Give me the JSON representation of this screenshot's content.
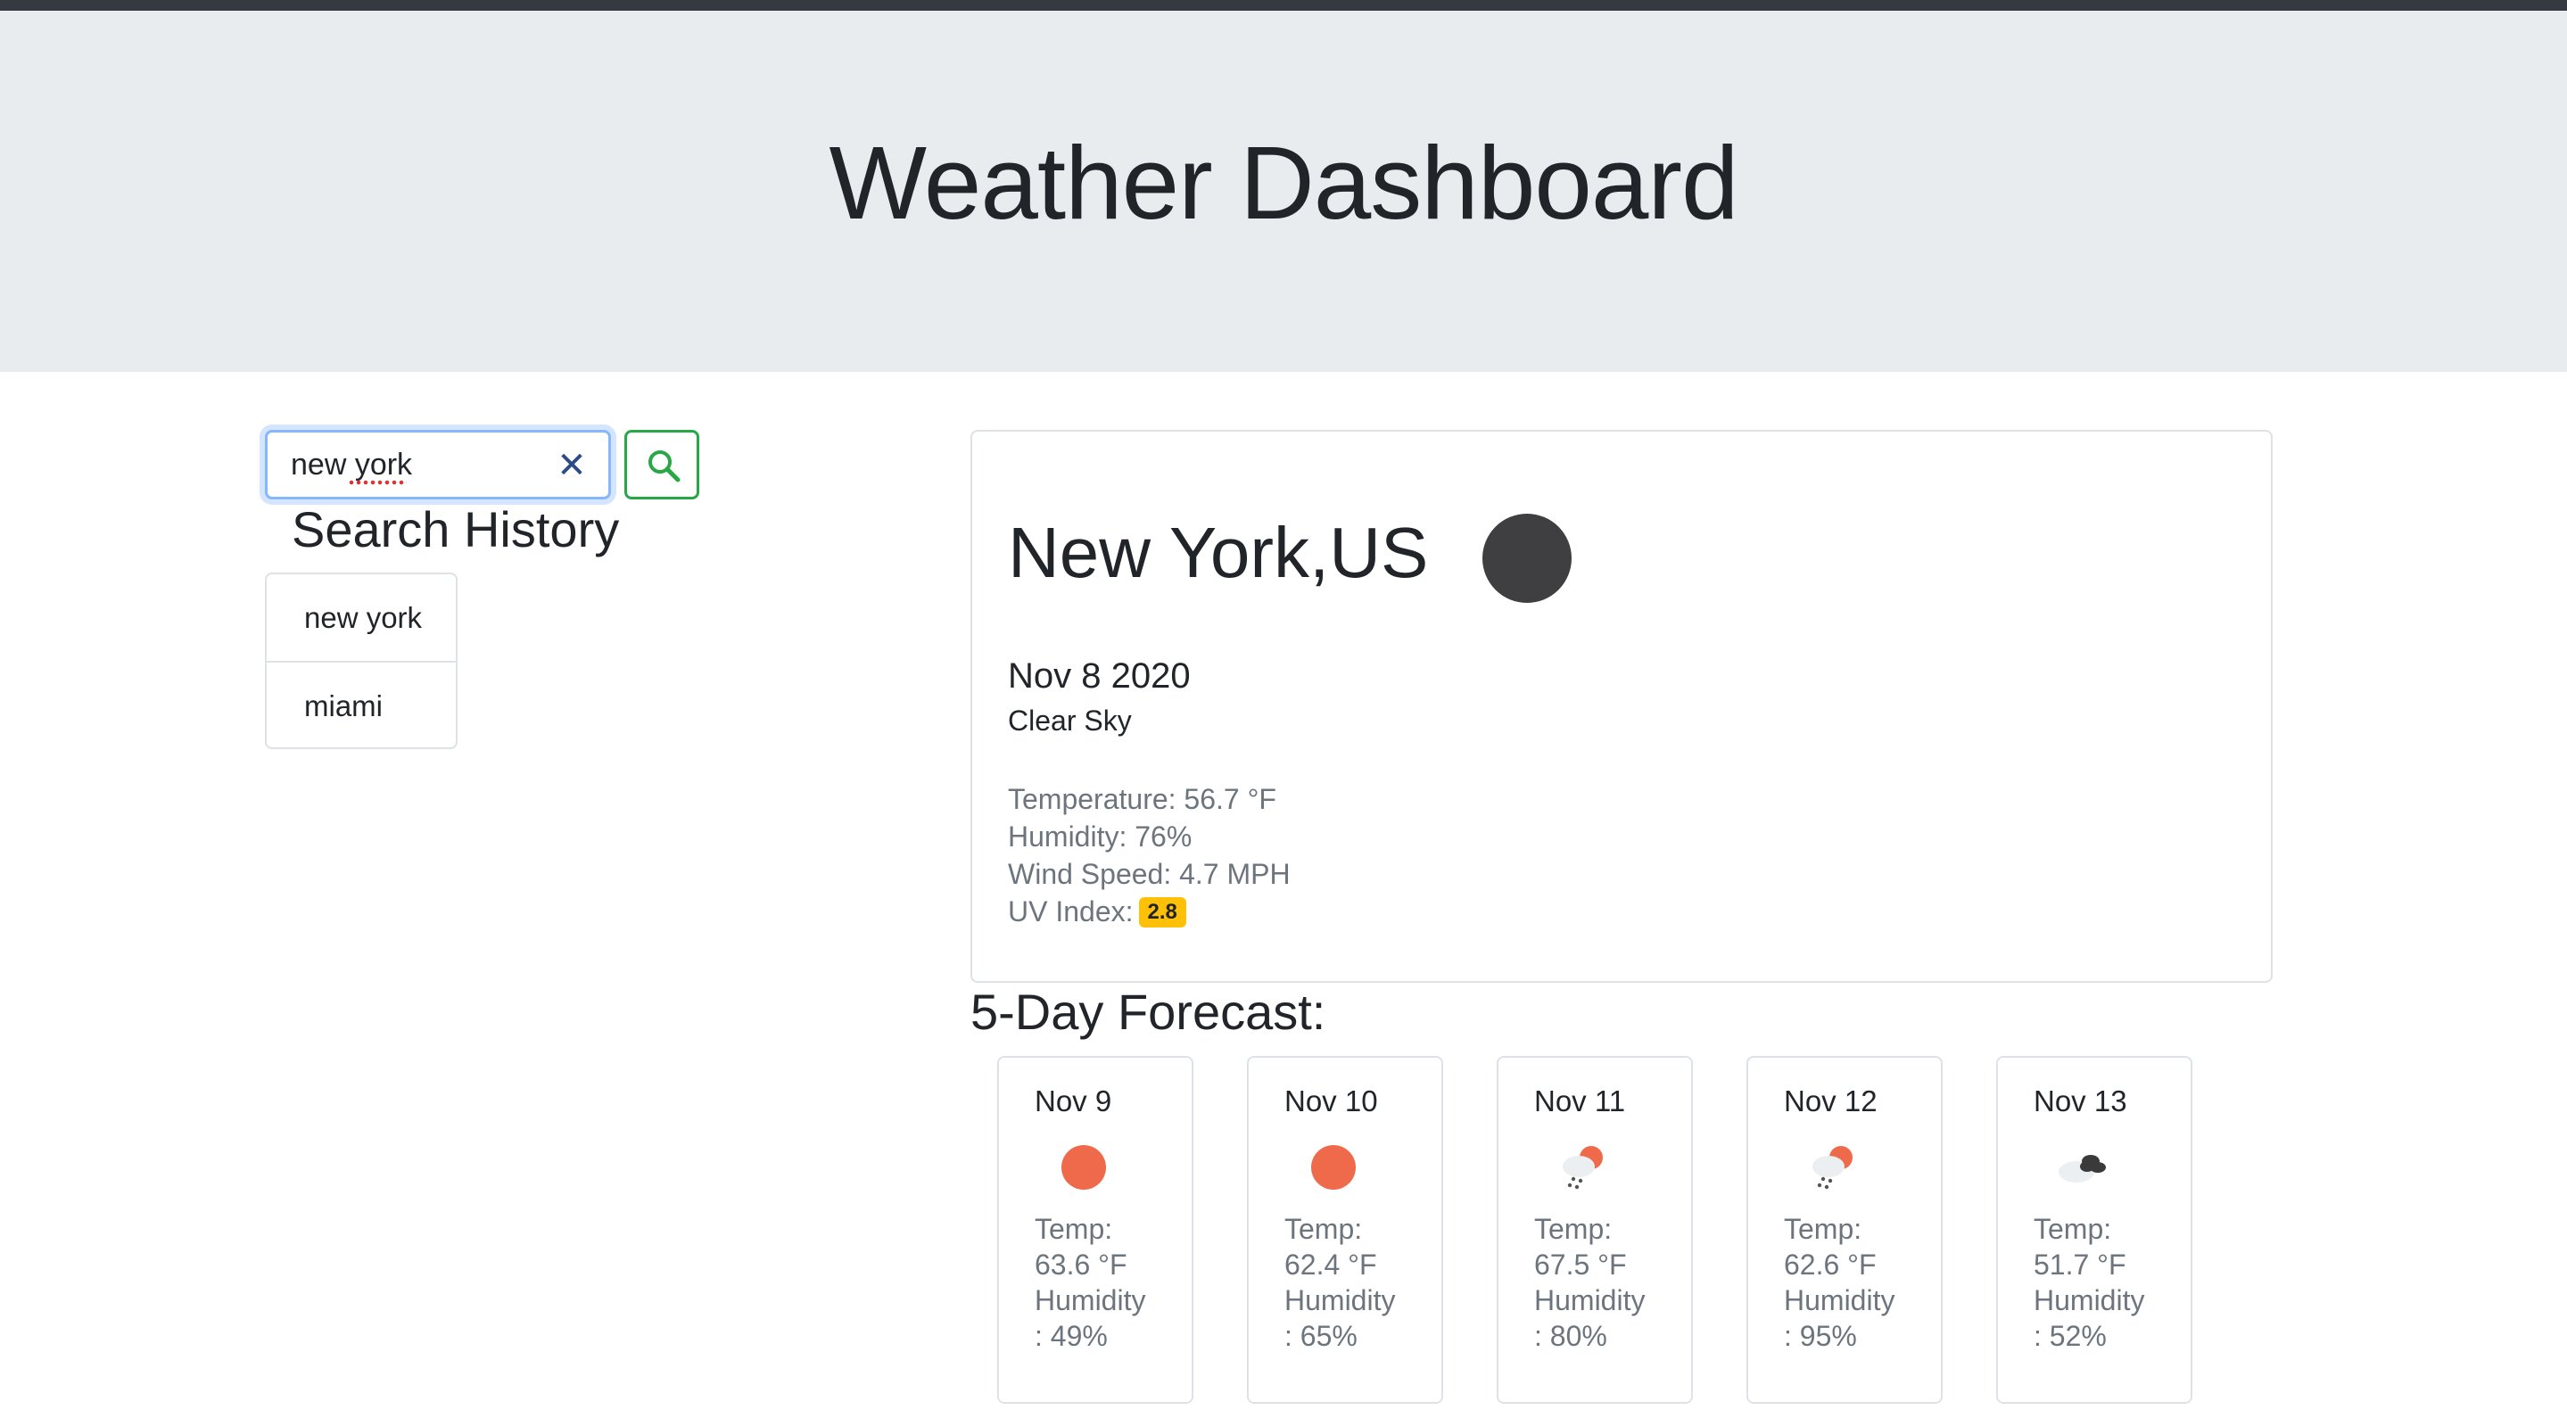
{
  "header": {
    "title": "Weather Dashboard"
  },
  "search": {
    "value": "new york",
    "clear_icon": "close-icon",
    "button_icon": "search-icon",
    "accent_color": "#28a745"
  },
  "history": {
    "heading": "Search History",
    "items": [
      {
        "label": "new york"
      },
      {
        "label": "miami"
      }
    ]
  },
  "current": {
    "city": "New York,US",
    "icon": "clear-night-icon",
    "date": "Nov 8 2020",
    "description": "Clear Sky",
    "temperature": "Temperature: 56.7 °F",
    "humidity": "Humidity: 76%",
    "wind": "Wind Speed: 4.7 MPH",
    "uv_label": "UV Index:",
    "uv_value": "2.8",
    "uv_color": "#ffc107"
  },
  "forecast": {
    "heading": "5-Day Forecast:",
    "days": [
      {
        "date": "Nov 9",
        "icon": "sun-icon",
        "temp_label": "Temp:",
        "temp": "63.6 °F",
        "hum_label": "Humidity",
        "hum": ": 49%"
      },
      {
        "date": "Nov 10",
        "icon": "sun-icon",
        "temp_label": "Temp:",
        "temp": "62.4 °F",
        "hum_label": "Humidity",
        "hum": ": 65%"
      },
      {
        "date": "Nov 11",
        "icon": "rain-sun-cloud-icon",
        "temp_label": "Temp:",
        "temp": "67.5 °F",
        "hum_label": "Humidity",
        "hum": ": 80%"
      },
      {
        "date": "Nov 12",
        "icon": "rain-sun-cloud-icon",
        "temp_label": "Temp:",
        "temp": "62.6 °F",
        "hum_label": "Humidity",
        "hum": ": 95%"
      },
      {
        "date": "Nov 13",
        "icon": "broken-clouds-icon",
        "temp_label": "Temp:",
        "temp": "51.7 °F",
        "hum_label": "Humidity",
        "hum": ": 52%"
      }
    ]
  }
}
